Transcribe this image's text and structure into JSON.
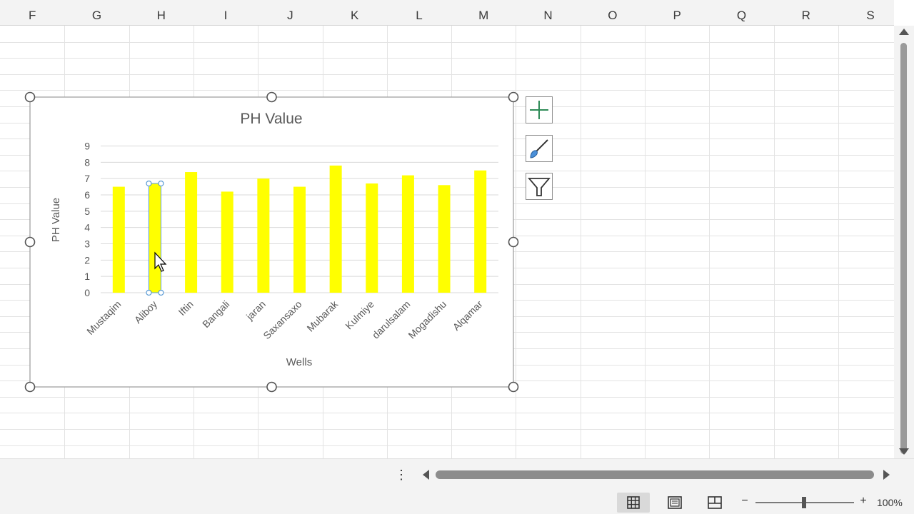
{
  "column_headers": [
    "F",
    "G",
    "H",
    "I",
    "J",
    "K",
    "L",
    "M",
    "N",
    "O",
    "P",
    "Q",
    "R",
    "S"
  ],
  "chart_data": {
    "type": "bar",
    "title": "PH Value",
    "xlabel": "Wells",
    "ylabel": "PH Value",
    "categories": [
      "Mustaqim",
      "Aliboy",
      "Iftin",
      "Bangali",
      "jaran",
      "Saxansaxo",
      "Mubarak",
      "Kulmiye",
      "darulsalam",
      "Mogadishu",
      "Alqamar"
    ],
    "series": [
      {
        "values": [
          6.5,
          6.7,
          7.4,
          6.2,
          7.0,
          6.5,
          7.8,
          6.7,
          7.2,
          6.6,
          7.5
        ]
      }
    ],
    "ylim": [
      0,
      9
    ],
    "yticks": [
      "0",
      "1",
      "2",
      "3",
      "4",
      "5",
      "6",
      "7",
      "8",
      "9"
    ],
    "grid": true,
    "bar_color": "#ffff00",
    "selected_category": "Aliboy"
  },
  "chart_side_buttons": {
    "elements_icon": "plus-icon",
    "styles_icon": "paintbrush-icon",
    "filters_icon": "funnel-icon"
  },
  "status_bar": {
    "zoom_minus": "−",
    "zoom_plus": "+",
    "zoom_level": "100%",
    "zoom_value": 1.0
  },
  "sheet_bar": {
    "more_label": "⋮"
  },
  "colors": {
    "grid_line": "#e3e3e3",
    "header_bg": "#f3f3f3",
    "bar": "#ffff00",
    "plus_icon": "#2e8b57",
    "selection_handle": "#5a9bd5"
  }
}
